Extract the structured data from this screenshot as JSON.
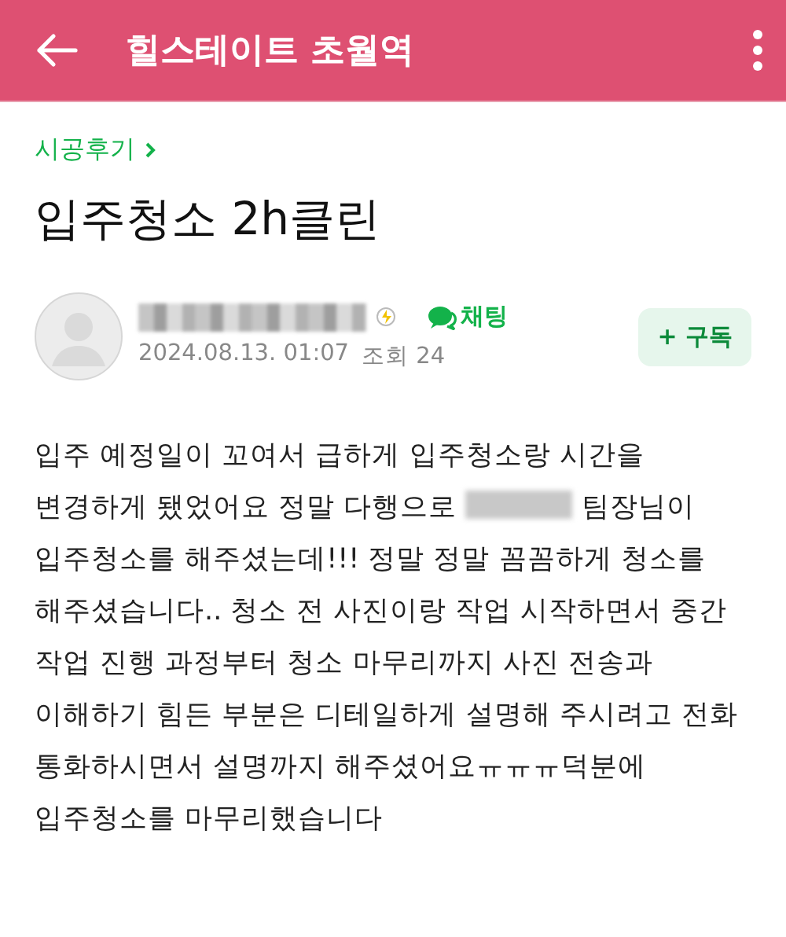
{
  "app_bar": {
    "title": "힐스테이트 초월역"
  },
  "category": "시공후기",
  "post": {
    "title": "입주청소 2h클린",
    "author": {
      "chat_label": "채팅",
      "date": "2024.08.13. 01:07",
      "views": "조회 24"
    },
    "subscribe_label": "+ 구독",
    "body_before": "입주 예정일이 꼬여서 급하게 입주청소랑 시간을 변경하게 됐었어요 정말 다행으로 ",
    "body_after": " 팀장님이 입주청소를 해주셨는데!!! 정말 정말 꼼꼼하게 청소를 해주셨습니다.. 청소 전 사진이랑 작업 시작하면서 중간 작업 진행 과정부터 청소 마무리까지 사진 전송과 이해하기 힘든 부분은 디테일하게 설명해 주시려고 전화 통화하시면서 설명까지 해주셨어요ㅠㅠㅠ덕분에 입주청소를 마무리했습니다"
  }
}
